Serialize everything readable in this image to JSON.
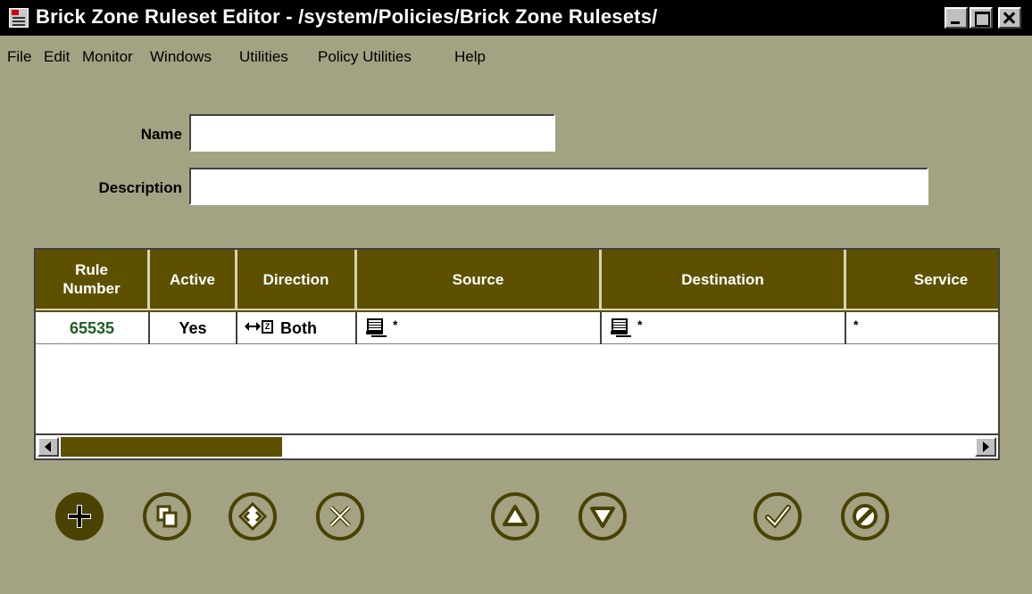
{
  "window": {
    "title": "Brick Zone Ruleset Editor - /system/Policies/Brick Zone Rulesets/"
  },
  "menu": {
    "items": [
      "File",
      "Edit",
      "Monitor",
      "Windows",
      "Utilities",
      "Policy Utilities",
      "Help"
    ]
  },
  "form": {
    "name_label": "Name",
    "name_value": "",
    "description_label": "Description",
    "description_value": ""
  },
  "table": {
    "headers": {
      "rule_number": "Rule\nNumber",
      "active": "Active",
      "direction": "Direction",
      "source": "Source",
      "destination": "Destination",
      "service": "Service"
    },
    "rows": [
      {
        "rule_number": "65535",
        "active": "Yes",
        "direction_icon_text": "Z",
        "direction": "Both",
        "source": "*",
        "destination": "*",
        "service": "*"
      }
    ]
  },
  "toolbar": {
    "buttons": [
      {
        "name": "add-rule-button",
        "icon": "plus-icon"
      },
      {
        "name": "copy-rule-button",
        "icon": "copy-icon"
      },
      {
        "name": "edit-rule-button",
        "icon": "diamond-arrows-icon"
      },
      {
        "name": "delete-rule-button",
        "icon": "x-icon"
      },
      {
        "name": "move-up-button",
        "icon": "triangle-up-icon"
      },
      {
        "name": "move-down-button",
        "icon": "triangle-down-icon"
      },
      {
        "name": "apply-button",
        "icon": "check-icon"
      },
      {
        "name": "cancel-button",
        "icon": "slash-circle-icon"
      }
    ]
  },
  "colors": {
    "background": "#a3a283",
    "header": "#5d5100",
    "button_dark": "#4a4200",
    "rule_number_text": "#1f5f1f"
  }
}
